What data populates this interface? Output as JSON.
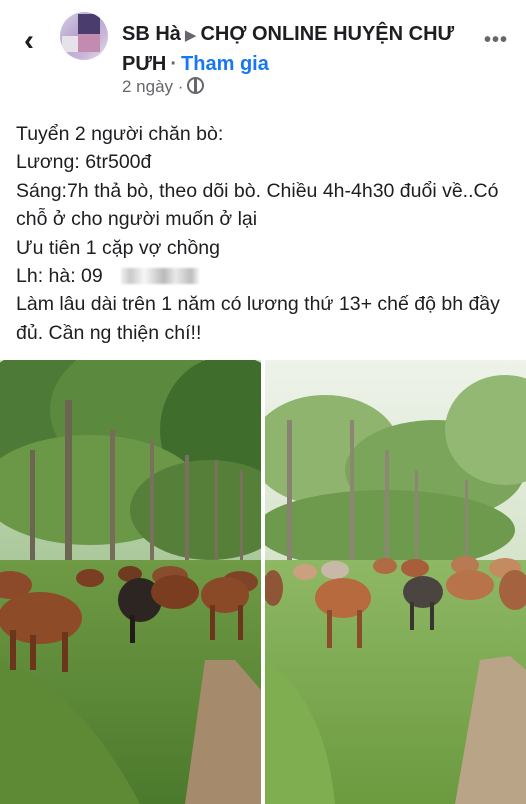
{
  "header": {
    "back_icon": "back-arrow-icon",
    "author": "SB Hà",
    "arrow_icon": "play-arrow-icon",
    "group": "CHỢ ONLINE HUYỆN CHƯ PƯH",
    "separator": "·",
    "join_label": "Tham gia",
    "time": "2 ngày",
    "time_separator": "·",
    "privacy_icon": "globe-icon",
    "more_icon": "more-dots-icon",
    "more_label": "•••"
  },
  "post": {
    "lines": [
      "Tuyển 2 người chăn bò:",
      "Lương: 6tr500đ",
      "Sáng:7h thả bò, theo dõi bò. Chiều 4h-4h30 đuổi về..Có chỗ ở cho người muốn ở lại",
      "Ưu tiên 1 cặp vợ chồng",
      "Lh: hà: 09",
      "Làm lâu dài trên 1 năm có lương thứ 13+ chế độ bh đầy đủ. Cần ng thiện chí!!"
    ]
  },
  "photos": [
    {
      "name": "cattle-photo-left"
    },
    {
      "name": "cattle-photo-right"
    }
  ]
}
